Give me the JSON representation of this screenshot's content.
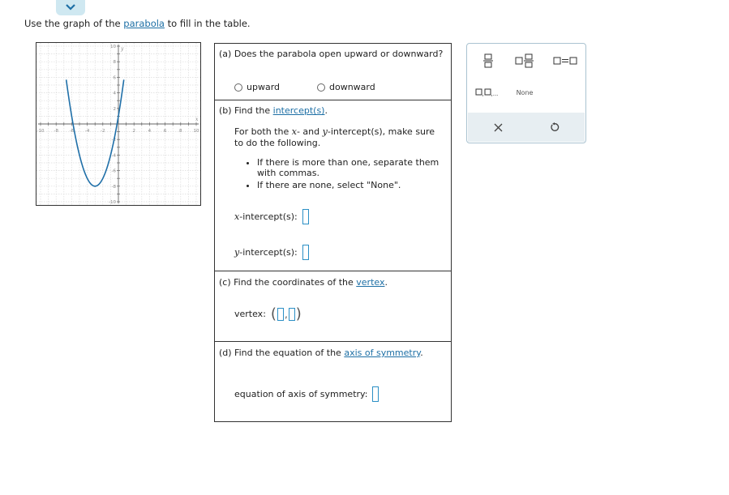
{
  "prompt": {
    "before": "Use the graph of the ",
    "link": "parabola",
    "after": " to fill in the table."
  },
  "graph": {
    "x_label": "x",
    "y_label": "y",
    "x_ticks": [
      "-10",
      "-8",
      "-6",
      "-4",
      "-2",
      "2",
      "4",
      "6",
      "8",
      "10"
    ],
    "y_ticks": [
      "10",
      "8",
      "6",
      "4",
      "2",
      "-2",
      "-4",
      "-6",
      "-8",
      "-10"
    ],
    "curve_color": "#1f6fa8"
  },
  "part_a": {
    "question": "(a) Does the parabola open upward or downward?",
    "options": [
      "upward",
      "downward"
    ]
  },
  "part_b": {
    "question_before": "(b) Find the ",
    "question_link": "intercept(s)",
    "question_after": ".",
    "instruction_1": "For both the ",
    "var_x": "x",
    "instruction_2": "- and ",
    "var_y": "y",
    "instruction_3": "-intercept(s), make sure",
    "instruction_line2": "to do the following.",
    "bullets": [
      "If there is more than one, separate them with commas.",
      "If there are none, select \"None\"."
    ],
    "x_intercept_label": "-intercept(s):",
    "y_intercept_label": "-intercept(s):"
  },
  "part_c": {
    "question_before": "(c) Find the coordinates of the ",
    "question_link": "vertex",
    "question_after": ".",
    "vertex_label": "vertex:"
  },
  "part_d": {
    "question_before": "(d) Find the equation of the ",
    "question_link": "axis of symmetry",
    "question_after": ".",
    "axis_label": "equation of axis of symmetry:"
  },
  "palette": {
    "none_label": "None",
    "accent": "#2b8fc5",
    "buttons": [
      "fraction-icon",
      "mixed-number-icon",
      "equals-icon",
      "ellipsis-list-icon",
      "none-button",
      "clear-icon",
      "undo-icon"
    ]
  }
}
